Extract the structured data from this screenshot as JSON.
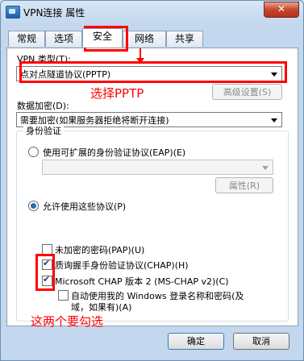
{
  "window": {
    "title": "VPN连接 属性",
    "close_glyph": "✕"
  },
  "tabs": [
    {
      "label": "常规",
      "active": false
    },
    {
      "label": "选项",
      "active": false
    },
    {
      "label": "安全",
      "active": true
    },
    {
      "label": "网络",
      "active": false
    },
    {
      "label": "共享",
      "active": false
    }
  ],
  "vpn_type": {
    "label": "VPN 类型(T):",
    "value": "点对点隧道协议(PPTP)"
  },
  "advanced_button": "高级设置(S)",
  "encryption": {
    "label": "数据加密(D):",
    "value": "需要加密(如果服务器拒绝将断开连接)"
  },
  "auth": {
    "group_title": "身份验证",
    "eap_radio": "使用可扩展的身份验证协议(EAP)(E)",
    "eap_select_value": "",
    "properties_button": "属性(R)",
    "allow_radio": "允许使用这些协议(P)",
    "protocols": [
      {
        "label": "未加密的密码(PAP)(U)",
        "checked": false
      },
      {
        "label": "质询握手身份验证协议(CHAP)(H)",
        "checked": true
      },
      {
        "label": "Microsoft CHAP 版本 2 (MS-CHAP v2)(C)",
        "checked": true
      }
    ],
    "windows_login": {
      "line1": "自动使用我的 Windows 登录名称和密码(及",
      "line2": "域，如果有)(A)",
      "checked": false
    }
  },
  "annotations": {
    "select_pptp": "选择PPTP",
    "check_both": "这两个要勾选",
    "color": "#ff0000"
  },
  "footer": {
    "ok": "确定",
    "cancel": "取消"
  }
}
